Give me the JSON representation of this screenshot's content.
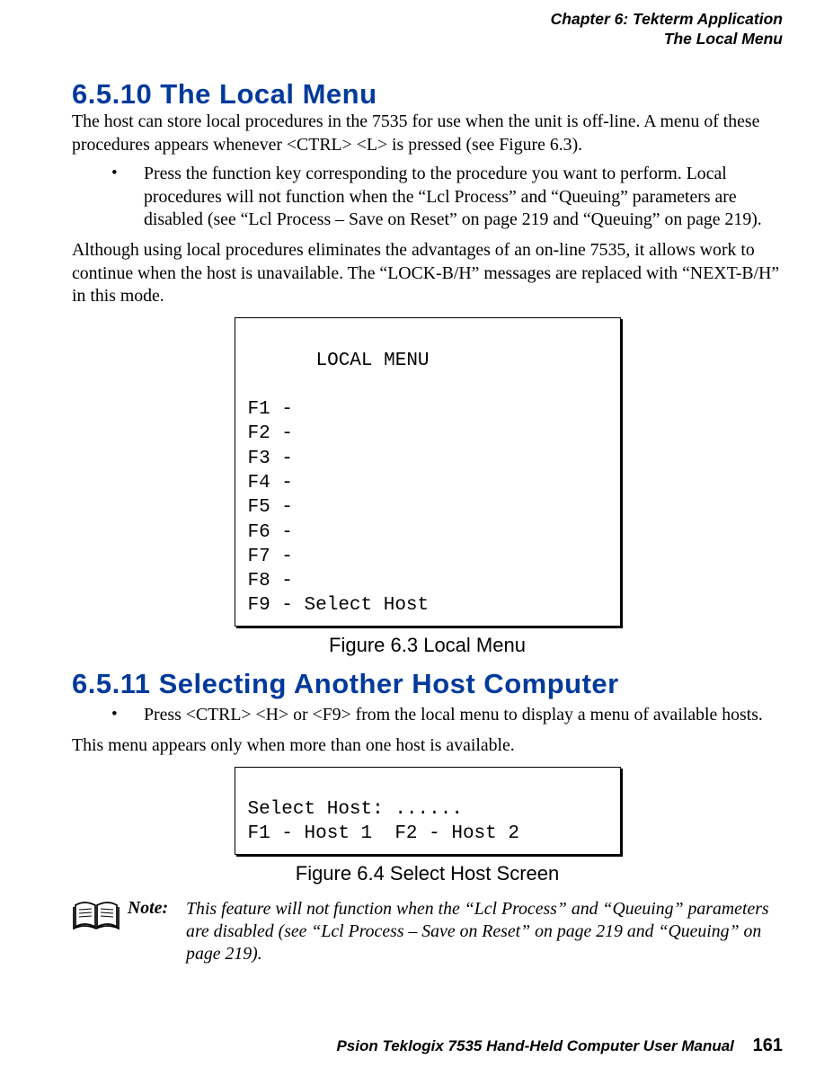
{
  "header": {
    "chapter_line": "Chapter 6: Tekterm Application",
    "section_line": "The Local Menu"
  },
  "s_6_5_10": {
    "title": "6.5.10  The Local Menu",
    "p1": "The host can store local procedures in the 7535 for use when the unit is off-line. A menu of these procedures appears whenever  <CTRL> <L> is pressed (see Figure 6.3).",
    "bullet1": "Press the function key corresponding to the procedure you want to perform. Local procedures will not function when the “Lcl Process” and “Queuing” parameters are disabled (see “Lcl Process – Save on Reset” on page 219 and “Queuing” on page 219).",
    "p2": "Although using local procedures eliminates the advantages of an on-line 7535, it allows work to continue when the host is unavailable. The “LOCK-B/H” messages are replaced with “NEXT-B/H” in this mode."
  },
  "fig63": {
    "menu_title": "LOCAL MENU",
    "rows": [
      "F1 -",
      "F2 -",
      "F3 -",
      "F4 -",
      "F5 -",
      "F6 -",
      "F7 -",
      "F8 -",
      "F9 - Select Host"
    ],
    "caption": "Figure 6.3 Local Menu"
  },
  "s_6_5_11": {
    "title": "6.5.11  Selecting Another Host Computer",
    "bullet1": "Press  <CTRL> <H> or <F9> from the local menu to display a menu of available hosts.",
    "p1": "This menu appears only when more than one host is available."
  },
  "fig64": {
    "lines": [
      "Select Host: ......",
      "F1 - Host 1  F2 - Host 2"
    ],
    "caption": "Figure 6.4 Select Host Screen"
  },
  "note": {
    "label": "Note:",
    "text": "This feature will not function when the “Lcl Process” and “Queuing” parameters are disabled (see “Lcl Process – Save on Reset” on page 219 and “Queuing” on page 219)."
  },
  "footer": {
    "book": "Psion Teklogix 7535 Hand-Held Computer User Manual",
    "page": "161"
  }
}
